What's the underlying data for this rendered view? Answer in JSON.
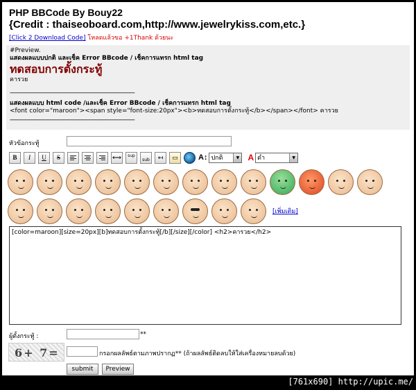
{
  "header": {
    "title_line1": "PHP BBCode By Bouy22",
    "title_line2": "{Credit : thaiseoboard.com,http://www.jewelrykiss.com,etc.}"
  },
  "download": {
    "link_text": "[Click 2 Download Code]",
    "thanks_text": " โหลดแล้วขอ +1Thank ด้วยนะ"
  },
  "preview": {
    "heading": "#Preview.",
    "normal_title": "แสดงผลแบบปกติ และเช็ค Error BBcode / เช็คการแทรก html tag",
    "topic": "ทดสอบการตั้งกระทู้",
    "body": "คารวย",
    "separator": "--------------------------------------------------------------------------------",
    "code_title": "แสดงผลแบบ html code /และเช็ค Error BBcode / เช็คการแทรก html tag",
    "code": "<font color=\"maroon\"><span style=\"font-size:20px\"><b>ทดสอบการตั้งกระทู้</b></span></font> คารวย",
    "separator2": "--------------------------------------------------------------------------------"
  },
  "form": {
    "title_label": "หัวข้อกระทู้",
    "title_value": "",
    "size_select": "ปกติ",
    "color_select": "ดำ",
    "more_link": "[เพิ่มเติม]",
    "message": "[color=maroon][size=20px][b]ทดสอบการตั้งกระทู้[/b][/size][/color] <h2>คารวย</h2>",
    "poster_label": "ผู้ตั้งกระทู้ :",
    "poster_value": "",
    "required_mark": "**",
    "captcha_text": "6+ 7=",
    "captcha_value": "",
    "captcha_hint": "กรอกผลลัพธ์ตามภาพปรากฏ** (ถ้าผลลัพธ์ติดลบให้ใส่เครื่องหมายลบด้วย)",
    "submit_label": "submit",
    "preview_label": "Preview"
  },
  "toolbar": {
    "bold": "B",
    "italic": "I",
    "underline": "U",
    "strike": "S",
    "sup": "sup",
    "sub": "sub",
    "size_icon": "A↕",
    "color_icon": "A"
  },
  "watermark": "[761x690] http://upic.me/"
}
